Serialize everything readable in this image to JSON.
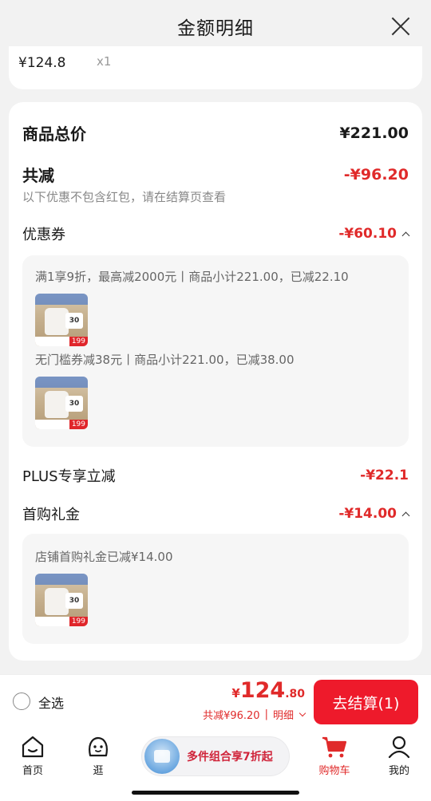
{
  "header": {
    "title": "金额明细"
  },
  "top_item": {
    "price": "¥124.8",
    "qty": "x1"
  },
  "summary": {
    "total_label": "商品总价",
    "total_value": "¥221.00",
    "reduce_label": "共减",
    "reduce_value": "-¥96.20",
    "note": "以下优惠不包含红包，请在结算页查看",
    "coupon_label": "优惠券",
    "coupon_value": "-¥60.10",
    "coupon_lines": [
      "满1享9折，最高减2000元丨商品小计221.00，已减22.10",
      "无门槛券减38元丨商品小计221.00，已减38.00"
    ],
    "plus_label": "PLUS专享立减",
    "plus_value": "-¥22.1",
    "gift_label": "首购礼金",
    "gift_value": "-¥14.00",
    "gift_line": "店铺首购礼金已减¥14.00",
    "thumb_price": "199",
    "thumb_badge": "30"
  },
  "bottom": {
    "select_all": "全选",
    "total_yen": "¥",
    "total_int": "124",
    "total_dec": ".80",
    "reduce_text": "共减¥96.20",
    "detail_text": "明细",
    "checkout": "去结算(1)"
  },
  "tabbar": {
    "home": "首页",
    "browse": "逛",
    "promo": "多件组合享7折起",
    "cart": "购物车",
    "mine": "我的"
  },
  "colors": {
    "accent_red": "#e02a2a",
    "checkout_red": "#ee1a2b"
  }
}
